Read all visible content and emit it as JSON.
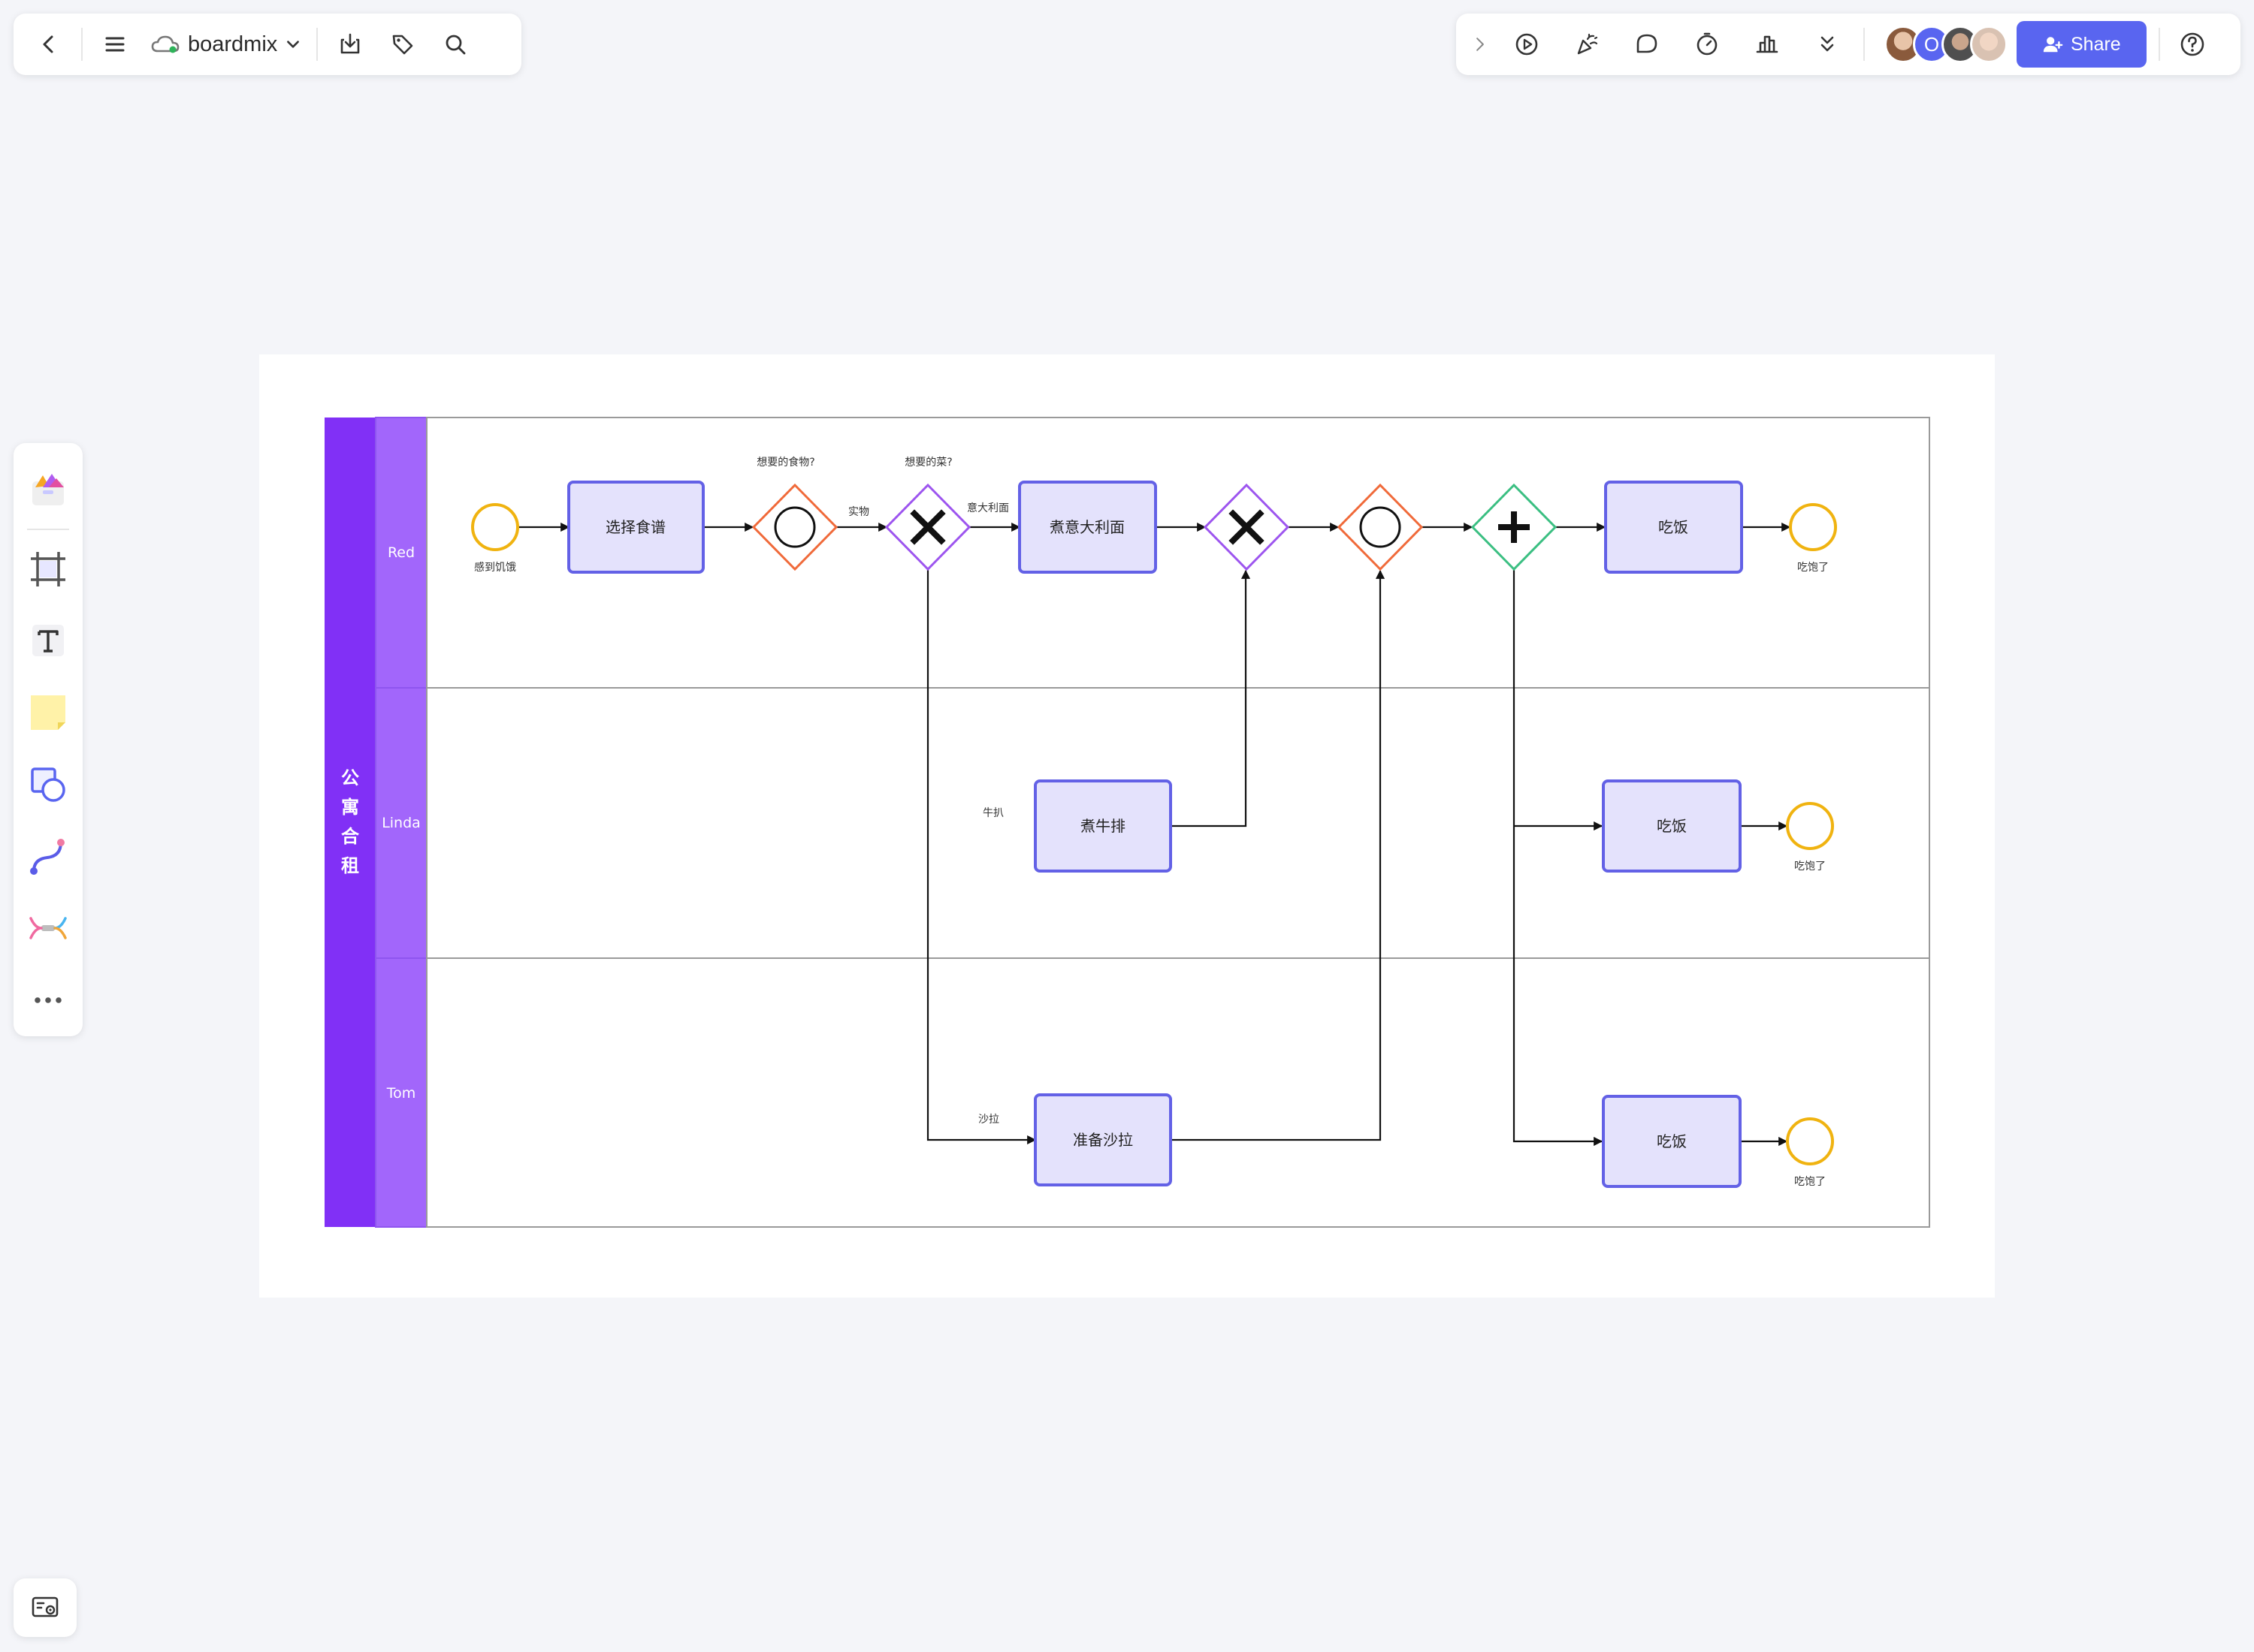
{
  "toolbar": {
    "brand_name": "boardmix",
    "share_label": "Share"
  },
  "icons": {
    "back": "chevron-left-icon",
    "menu": "hamburger-icon",
    "cloud": "cloud-icon",
    "dropdown": "chevron-down-icon",
    "download": "download-icon",
    "tag": "tag-icon",
    "search": "search-icon",
    "expand": "chevron-right-icon",
    "play": "play-icon",
    "celebrate": "party-popper-icon",
    "comment": "comment-icon",
    "timer": "timer-icon",
    "vote": "bar-chart-icon",
    "more": "double-chevron-down-icon",
    "share_user": "user-plus-icon",
    "help": "help-icon"
  },
  "avatars": {
    "second_initial": "O"
  },
  "colors": {
    "accent": "#5965f0",
    "pool_header": "#8130f6",
    "lane_header": "#a266fb",
    "task_fill": "#e4e2fc",
    "task_border": "#6361e6",
    "event": "#f0b310",
    "gateway_orange": "#f06a3a",
    "gateway_purple": "#9d55ef",
    "gateway_green": "#3bbf82"
  },
  "diagram": {
    "pool_label": "公寓合租",
    "lanes": [
      "Red",
      "Linda",
      "Tom"
    ],
    "tasks": {
      "choose_recipe": "选择食谱",
      "cook_pasta": "煮意大利面",
      "eat_red": "吃饭",
      "cook_steak": "煮牛排",
      "eat_linda": "吃饭",
      "prepare_salad": "准备沙拉",
      "eat_tom": "吃饭"
    },
    "events": {
      "start": "感到饥饿",
      "end_red": "吃饱了",
      "end_linda": "吃饱了",
      "end_tom": "吃饱了"
    },
    "gateway_labels": {
      "food_wanted": "想要的食物?",
      "dish_wanted": "想要的菜?"
    },
    "flow_labels": {
      "food": "实物",
      "pasta": "意大利面",
      "steak": "牛扒",
      "salad": "沙拉"
    }
  }
}
